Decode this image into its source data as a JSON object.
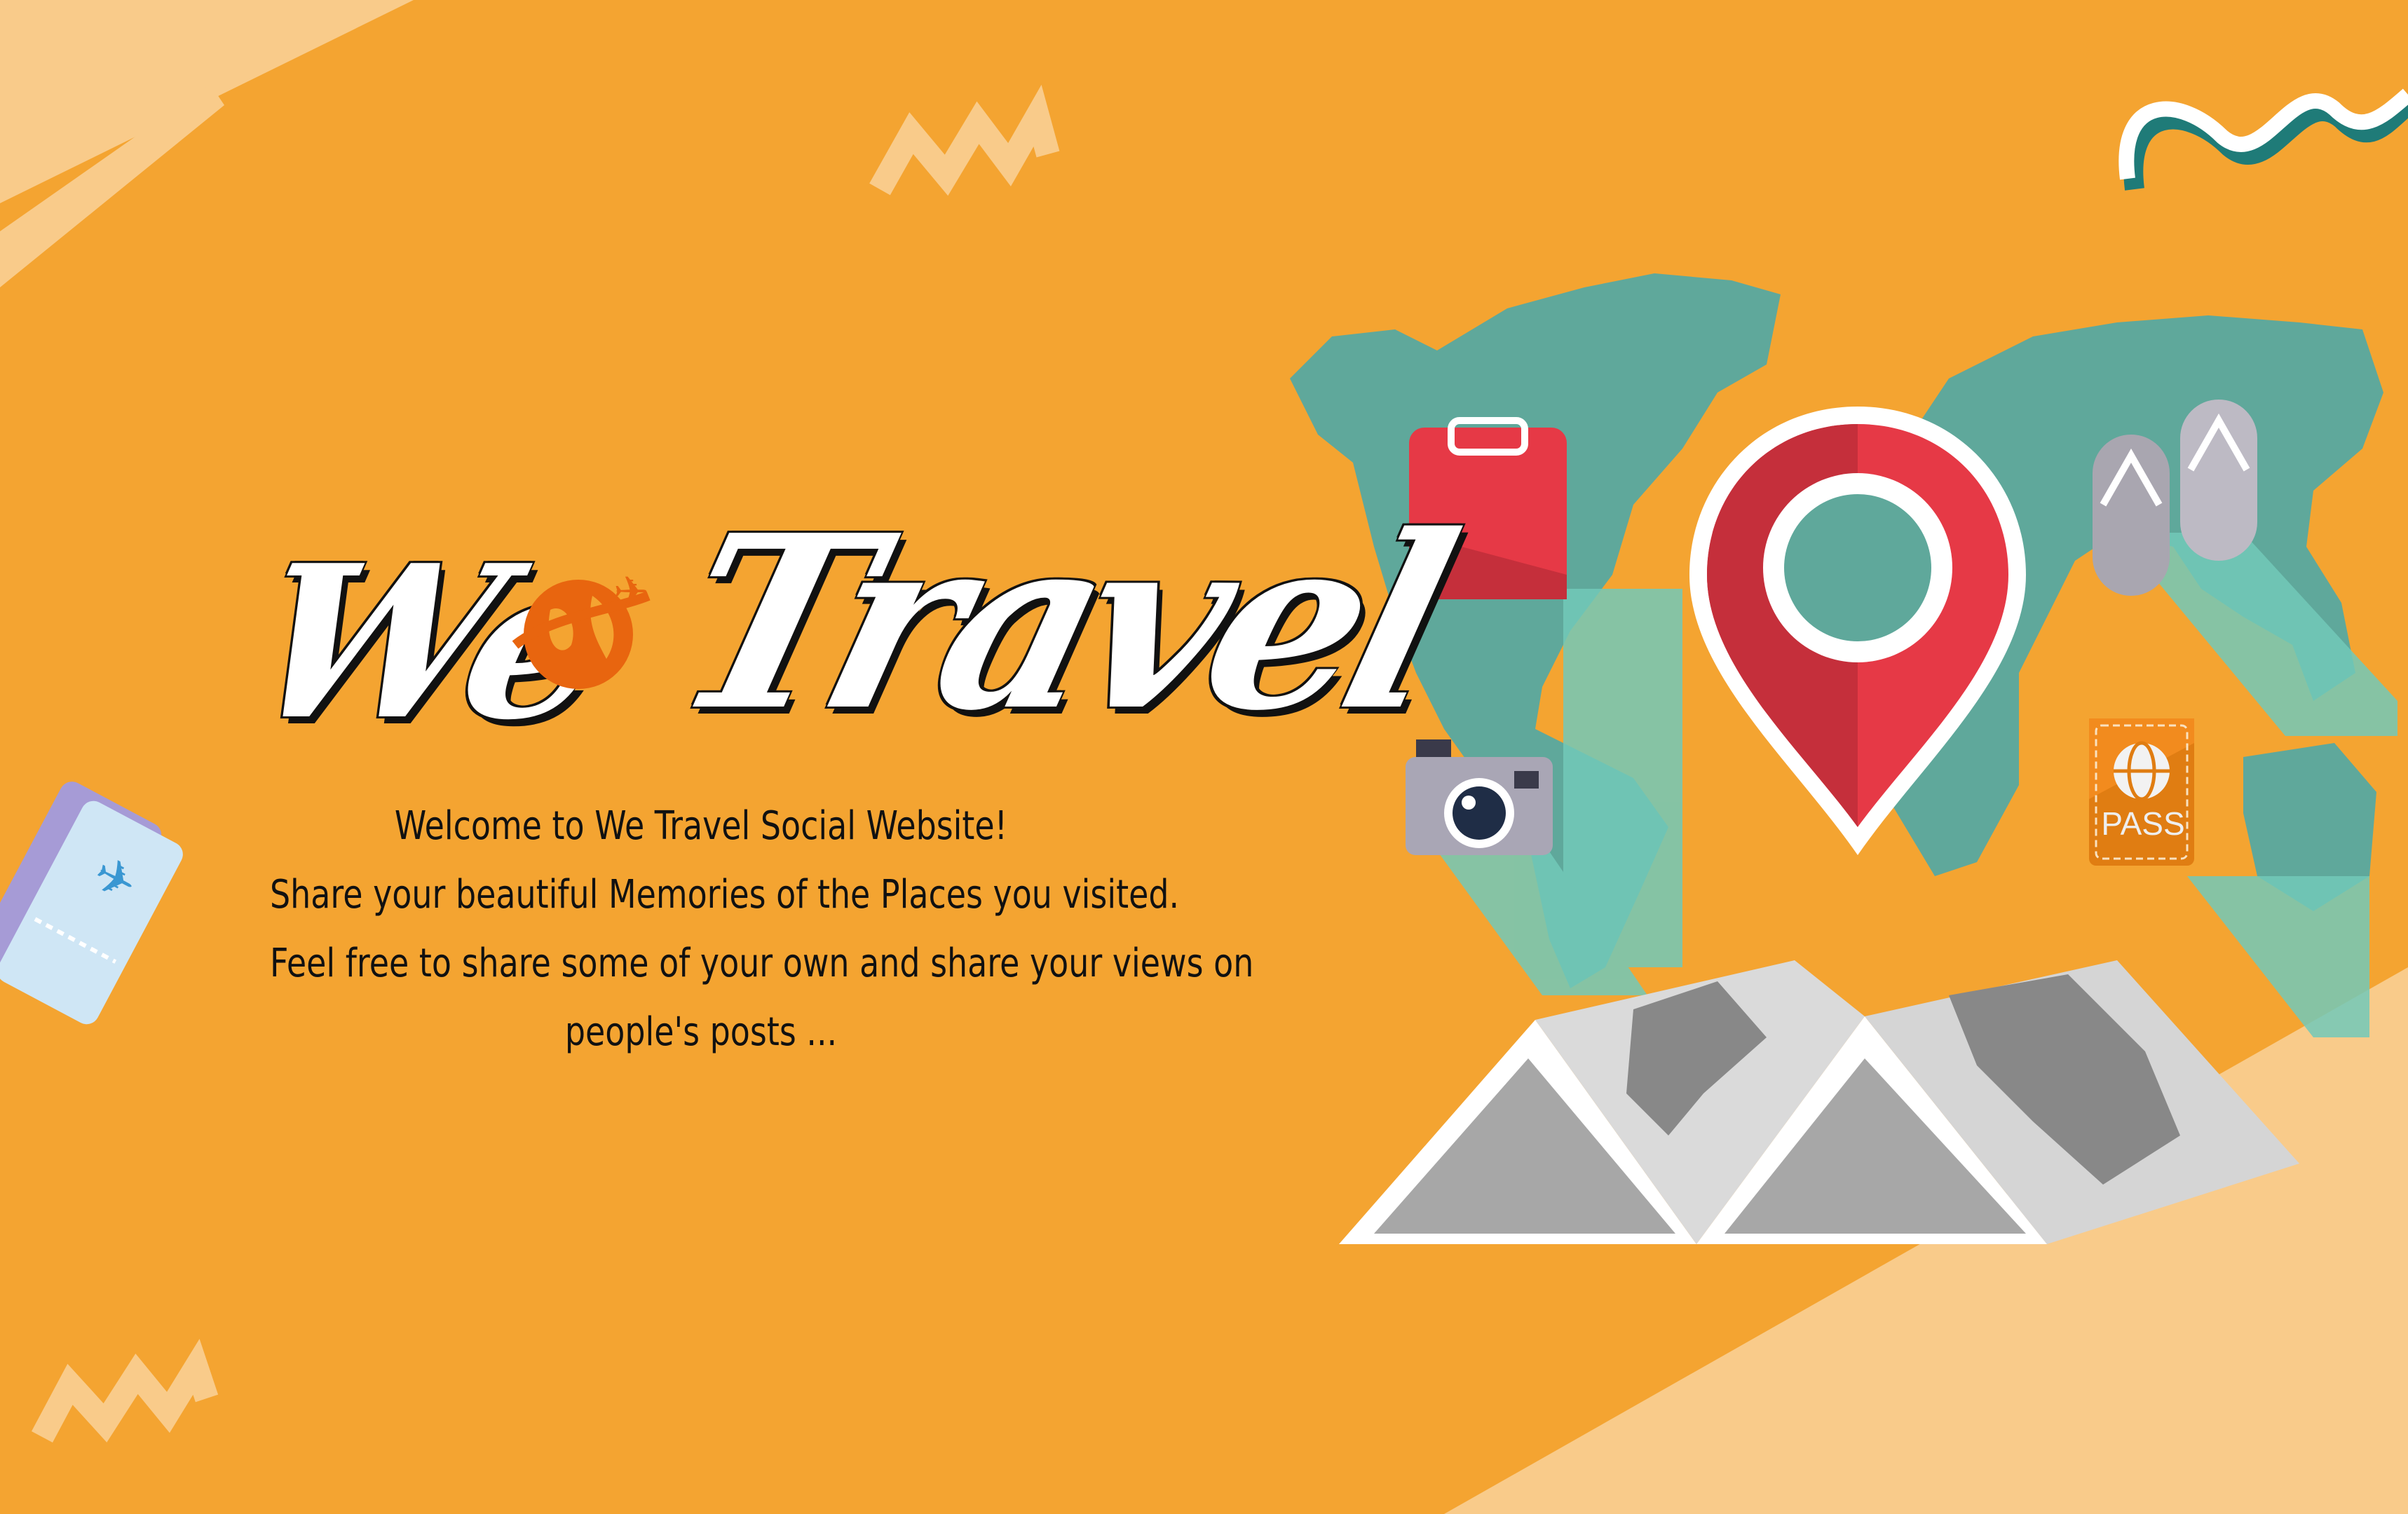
{
  "logo": {
    "text_1": "We",
    "text_2": "Travel"
  },
  "intro": {
    "lines": [
      "Welcome to We Travel Social Website!",
      "Share your beautiful Memories of the Places you visited.",
      "Feel free to share some of your own and share your views on",
      "people's posts ..."
    ]
  },
  "illustration": {
    "passport_label": "PASS"
  },
  "colors": {
    "background": "#F4A431",
    "stripe": "#F9CB8A",
    "map": "#5FA89B",
    "pin": "#E23A44"
  }
}
